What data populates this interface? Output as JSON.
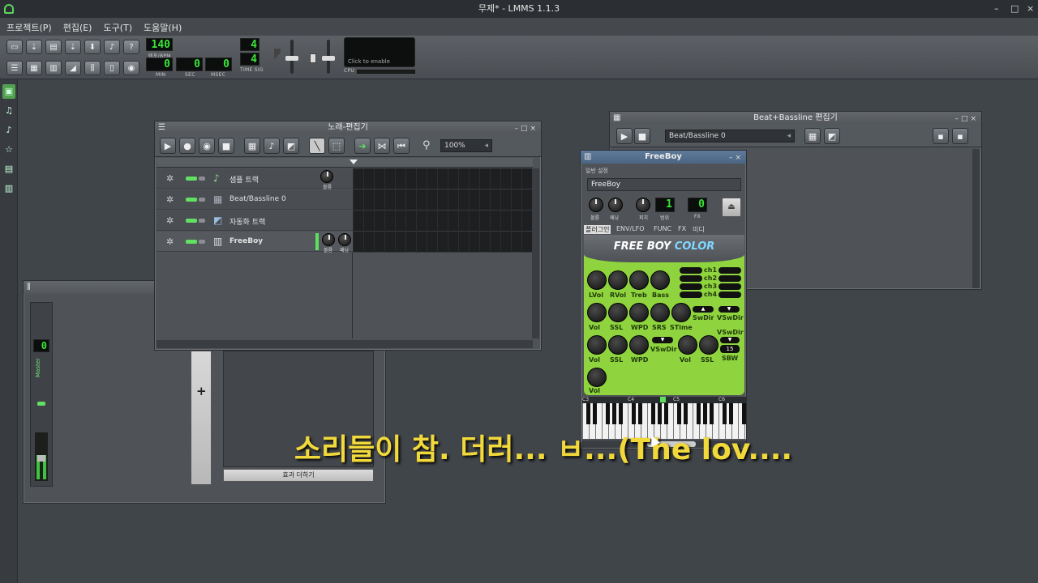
{
  "app": {
    "title": "무제* - LMMS 1.1.3",
    "window_controls": [
      "–",
      "□",
      "×"
    ]
  },
  "menu": [
    "프로젝트(P)",
    "편집(E)",
    "도구(T)",
    "도움말(H)"
  ],
  "toolbar": {
    "tempo": "140",
    "tempo_label": "템포/BPM",
    "time_min": "0",
    "time_sec": "0",
    "time_msec": "0",
    "min_label": "MIN",
    "sec_label": "SEC",
    "msec_label": "MSEC",
    "timesig_top": "4",
    "timesig_bottom": "4",
    "timesig_label": "TIME SIG",
    "cpu_text": "Click to enable",
    "cpu_label": "CPU"
  },
  "song_editor": {
    "title": "노래-편집기",
    "zoom": "100%",
    "tracks": [
      {
        "name": "샘플 트랙",
        "icon": "sample-icon"
      },
      {
        "name": "Beat/Bassline 0",
        "icon": "beat-icon"
      },
      {
        "name": "자동화 트랙",
        "icon": "automation-icon"
      },
      {
        "name": "FreeBoy",
        "icon": "instrument-icon"
      }
    ],
    "knob_labels": {
      "vol": "볼륨",
      "pan": "패닝"
    }
  },
  "bb_editor": {
    "title": "Beat+Bassline 편집기",
    "selected": "Beat/Bassline 0"
  },
  "mixer": {
    "master_value": "0",
    "master_label": "Master",
    "add_effect": "효과 더하기"
  },
  "instrument": {
    "title": "FreeBoy",
    "section": "일반 설정",
    "name": "FreeBoy",
    "knob_vol": "볼륨",
    "knob_pan": "패닝",
    "knob_pitch": "피치",
    "knob_range": "범위",
    "range_value": "1",
    "fx_value": "0",
    "fx_label": "FX",
    "tabs": [
      "플러그인",
      "ENV/LFO",
      "FUNC",
      "FX",
      "미디"
    ],
    "logo_a": "FREE BOY ",
    "logo_b": "COLOR",
    "ch_labels": [
      "ch1",
      "ch2",
      "ch3",
      "ch4"
    ],
    "row1_labels": [
      "LVol",
      "RVol",
      "Treb",
      "Bass"
    ],
    "row2_labels": [
      "Vol",
      "SSL",
      "WPD",
      "SRS",
      "STime"
    ],
    "row2_extra": [
      "SwDir",
      "VSwDir"
    ],
    "row3_labels": [
      "Vol",
      "SSL",
      "WPD"
    ],
    "row3_mid": "VSwDir",
    "row3b_labels": [
      "Vol",
      "SSL"
    ],
    "row3_right": [
      "VSwDir",
      "SBW"
    ],
    "sbw_value": "15",
    "row4_label": "Vol",
    "piano_labels": [
      "C3",
      "C4",
      "C5",
      "C6"
    ]
  },
  "subtitle": "소리들이 참. 더러... ㅂ...(The lov...."
}
